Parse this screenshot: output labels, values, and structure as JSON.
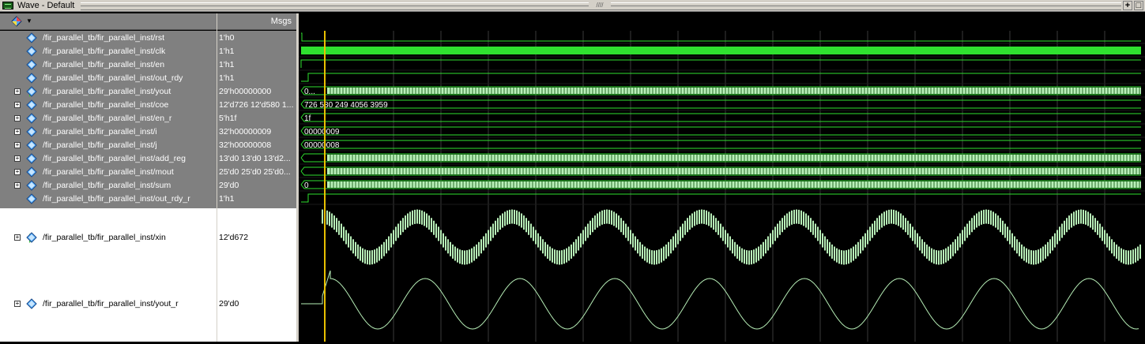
{
  "window": {
    "title": "Wave - Default"
  },
  "header": {
    "msgs_label": "Msgs"
  },
  "signals": [
    {
      "path": "/fir_parallel_tb/fir_parallel_inst/rst",
      "value": "1'h0",
      "bus": false
    },
    {
      "path": "/fir_parallel_tb/fir_parallel_inst/clk",
      "value": "1'h1",
      "bus": false
    },
    {
      "path": "/fir_parallel_tb/fir_parallel_inst/en",
      "value": "1'h1",
      "bus": false
    },
    {
      "path": "/fir_parallel_tb/fir_parallel_inst/out_rdy",
      "value": "1'h1",
      "bus": false
    },
    {
      "path": "/fir_parallel_tb/fir_parallel_inst/yout",
      "value": "29'h00000000",
      "bus": true
    },
    {
      "path": "/fir_parallel_tb/fir_parallel_inst/coe",
      "value": "12'd726 12'd580 1...",
      "bus": true
    },
    {
      "path": "/fir_parallel_tb/fir_parallel_inst/en_r",
      "value": "5'h1f",
      "bus": true
    },
    {
      "path": "/fir_parallel_tb/fir_parallel_inst/i",
      "value": "32'h00000009",
      "bus": true
    },
    {
      "path": "/fir_parallel_tb/fir_parallel_inst/j",
      "value": "32'h00000008",
      "bus": true
    },
    {
      "path": "/fir_parallel_tb/fir_parallel_inst/add_reg",
      "value": "13'd0 13'd0 13'd2...",
      "bus": true
    },
    {
      "path": "/fir_parallel_tb/fir_parallel_inst/mout",
      "value": "25'd0 25'd0 25'd0...",
      "bus": true
    },
    {
      "path": "/fir_parallel_tb/fir_parallel_inst/sum",
      "value": "29'd0",
      "bus": true
    },
    {
      "path": "/fir_parallel_tb/fir_parallel_inst/out_rdy_r",
      "value": "1'h1",
      "bus": false
    },
    {
      "path": "/fir_parallel_tb/fir_parallel_inst/xin",
      "value": "12'd672",
      "bus": true
    },
    {
      "path": "/fir_parallel_tb/fir_parallel_inst/yout_r",
      "value": "29'd0",
      "bus": true
    }
  ],
  "wave_labels": {
    "yout": "0...",
    "coe": "726 580 249 4056 3959",
    "en_r": "1f",
    "i": "00000009",
    "j": "00000008",
    "sum": "0"
  },
  "colors": {
    "wave_green": "#2fe12f",
    "bus_fill": "#b8f0b8",
    "cursor": "#e8c000",
    "grid": "#3a3a3a"
  }
}
